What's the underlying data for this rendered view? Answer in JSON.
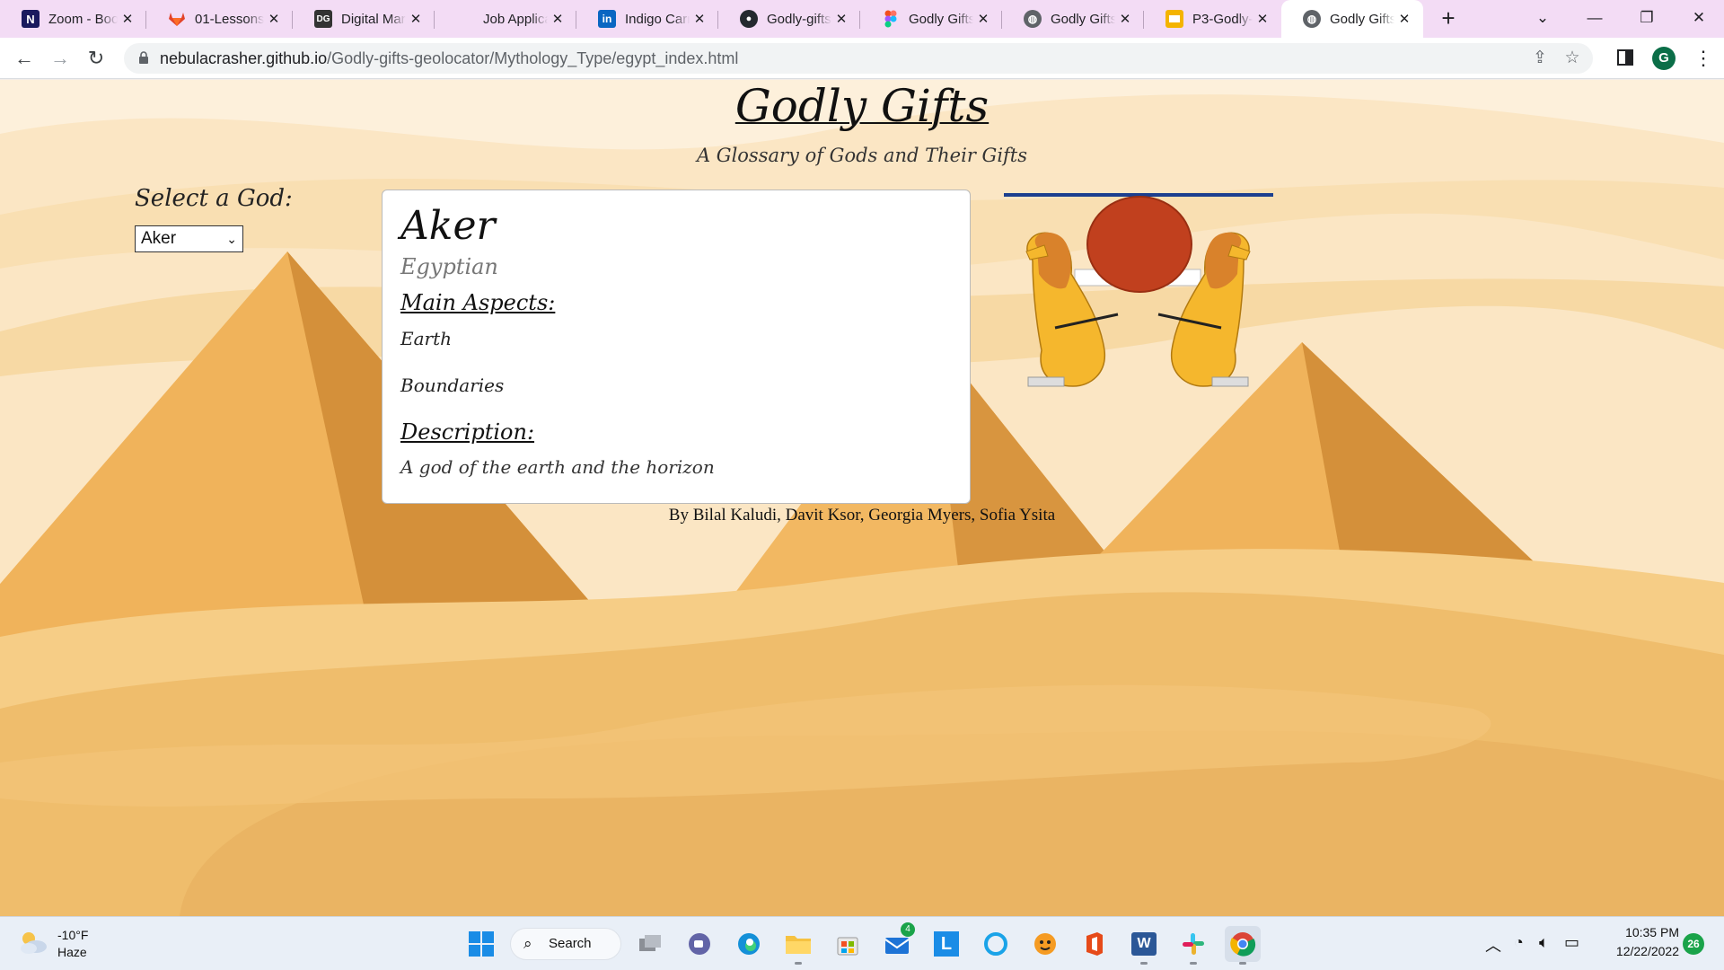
{
  "browser": {
    "tabs": [
      {
        "title": "Zoom - Boo",
        "icon": "notion-icon",
        "active": false
      },
      {
        "title": "01-Lessons/",
        "icon": "gitlab-icon",
        "active": false
      },
      {
        "title": "Digital Mar",
        "icon": "site-icon",
        "active": false
      },
      {
        "title": "Job Applica",
        "icon": "blank-icon",
        "active": false
      },
      {
        "title": "Indigo Carr",
        "icon": "linkedin-icon",
        "active": false
      },
      {
        "title": "Godly-gifts",
        "icon": "github-icon",
        "active": false
      },
      {
        "title": "Godly Gifts",
        "icon": "figma-icon",
        "active": false
      },
      {
        "title": "Godly Gifts",
        "icon": "globe-icon",
        "active": false
      },
      {
        "title": "P3-Godly-G",
        "icon": "slides-icon",
        "active": false
      },
      {
        "title": "Godly Gifts",
        "icon": "globe-icon",
        "active": true
      }
    ],
    "url_host": "nebulacrasher.github.io",
    "url_path": "/Godly-gifts-geolocator/Mythology_Type/egypt_index.html",
    "profile_initial": "G"
  },
  "page": {
    "site_title": "Godly Gifts",
    "site_subtitle": "A Glossary of Gods and Their Gifts",
    "select_label": "Select a God:",
    "selected_god": "Aker",
    "god": {
      "name": "Aker",
      "origin": "Egyptian",
      "aspects_heading": "Main Aspects:",
      "aspects": [
        "Earth",
        "Boundaries"
      ],
      "description_heading": "Description:",
      "description": "A god of the earth and the horizon"
    },
    "credits": "By Bilal Kaludi, Davit Ksor, Georgia Myers, Sofia Ysita"
  },
  "taskbar": {
    "weather_temp": "-10°F",
    "weather_condition": "Haze",
    "search_label": "Search",
    "mail_badge": "4",
    "time": "10:35 PM",
    "date": "12/22/2022",
    "notification_count": "26"
  },
  "colors": {
    "tabstrip": "#f3dcf5",
    "sand_light": "#fbe6c4",
    "pyramid": "#e9a94d",
    "sun_disk": "#c1401e",
    "lion": "#f5b72d"
  }
}
